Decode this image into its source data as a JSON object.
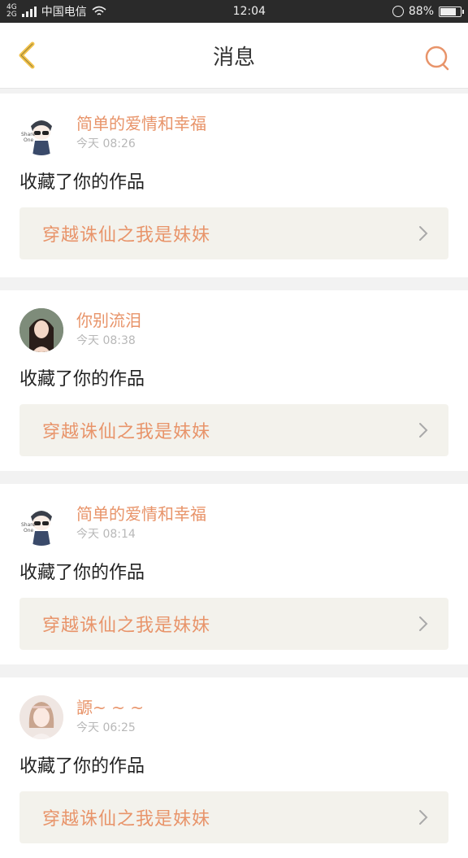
{
  "status": {
    "network_top": "4G",
    "network_bottom": "2G",
    "carrier": "中国电信",
    "time": "12:04",
    "battery": "88%",
    "battery_level": 0.88
  },
  "header": {
    "title": "消息",
    "back_icon": "chevron-left-icon",
    "search_icon": "search-icon"
  },
  "messages": [
    {
      "username": "简单的爱情和幸福",
      "time": "今天 08:26",
      "action": "收藏了你的作品",
      "work": "穿越诛仙之我是妹妹"
    },
    {
      "username": "你别流泪",
      "time": "今天 08:38",
      "action": "收藏了你的作品",
      "work": "穿越诛仙之我是妹妹"
    },
    {
      "username": "简单的爱情和幸福",
      "time": "今天 08:14",
      "action": "收藏了你的作品",
      "work": "穿越诛仙之我是妹妹"
    },
    {
      "username": "謜~ ~ ~",
      "time": "今天 06:25",
      "action": "收藏了你的作品",
      "work": "穿越诛仙之我是妹妹"
    }
  ],
  "colors": {
    "accent": "#e8946a",
    "back_icon": "#f2c24a",
    "work_bg": "#f3f2ec"
  }
}
